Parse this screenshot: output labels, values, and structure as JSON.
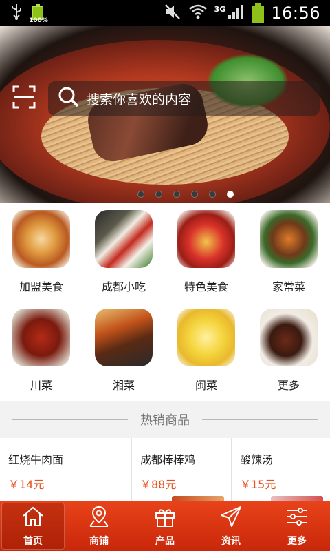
{
  "statusbar": {
    "battery_small_pct": "100%",
    "network": "3G",
    "time": "16:56"
  },
  "hero": {
    "search_placeholder": "搜索你喜欢的内容",
    "slide_count": 6,
    "active_slide": 6
  },
  "categories": [
    {
      "label": "加盟美食"
    },
    {
      "label": "成都小吃"
    },
    {
      "label": "特色美食"
    },
    {
      "label": "家常菜"
    },
    {
      "label": "川菜"
    },
    {
      "label": "湘菜"
    },
    {
      "label": "闽菜"
    },
    {
      "label": "更多"
    }
  ],
  "hot_section": {
    "title": "热销商品"
  },
  "products": [
    {
      "name": "红烧牛肉面",
      "price": "￥14元"
    },
    {
      "name": "成都棒棒鸡",
      "price": "￥88元"
    },
    {
      "name": "酸辣汤",
      "price": "￥15元"
    }
  ],
  "nav": [
    {
      "label": "首页",
      "icon": "home-icon"
    },
    {
      "label": "商铺",
      "icon": "map-pin-icon"
    },
    {
      "label": "产品",
      "icon": "gift-icon"
    },
    {
      "label": "资讯",
      "icon": "send-icon"
    },
    {
      "label": "更多",
      "icon": "sliders-icon"
    }
  ],
  "colors": {
    "accent": "#e8431a",
    "price": "#e8501e"
  }
}
